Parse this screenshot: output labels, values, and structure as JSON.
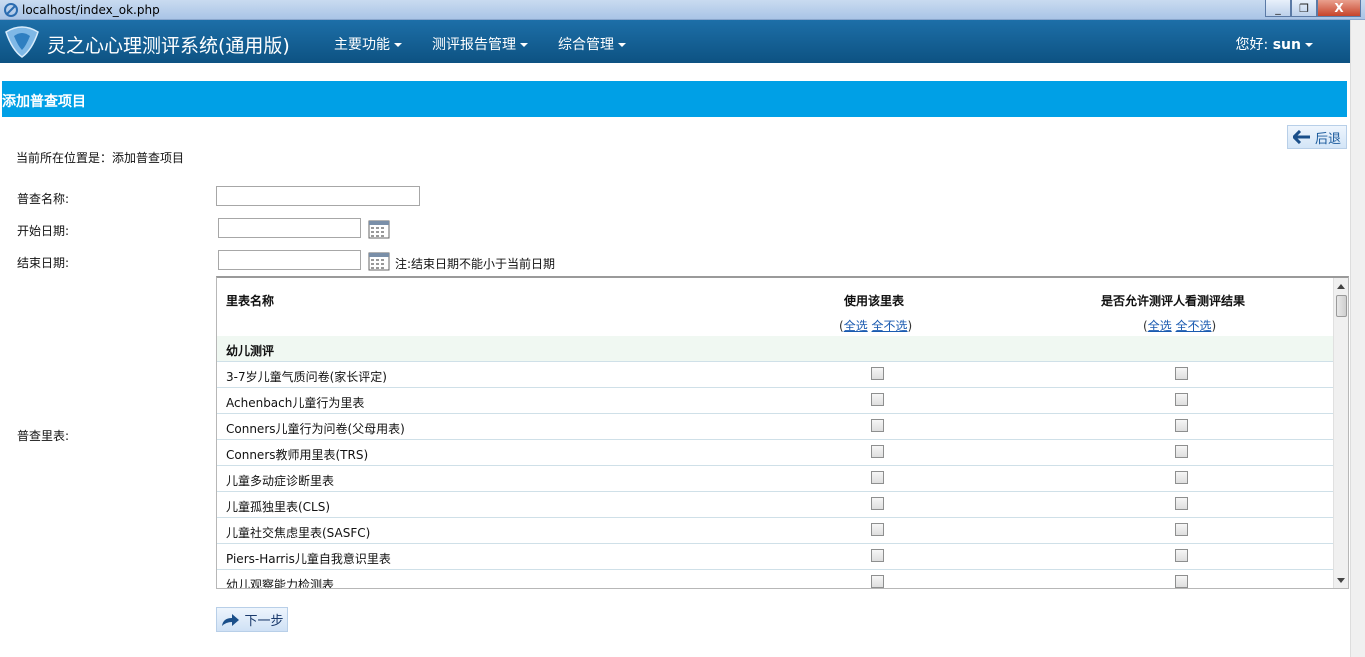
{
  "window": {
    "title": "localhost/index_ok.php",
    "minimize": "_",
    "maximize": "❐",
    "close": "X"
  },
  "navbar": {
    "brand": "灵之心心理测评系统(通用版)",
    "menu": [
      {
        "label": "主要功能"
      },
      {
        "label": "测评报告管理"
      },
      {
        "label": "综合管理"
      }
    ],
    "greeting_prefix": "您好:",
    "username": "sun"
  },
  "page": {
    "section_title": "添加普查项目",
    "back_label": "后退",
    "location": "当前所在位置是：添加普查项目",
    "labels": {
      "name": "普查名称:",
      "start": "开始日期:",
      "end": "结束日期:",
      "scales": "普查里表:"
    },
    "values": {
      "name": "",
      "start": "",
      "end": ""
    },
    "end_note": "注:结束日期不能小于当前日期",
    "next_label": "下一步"
  },
  "table": {
    "col_name": "里表名称",
    "col_use": "使用该里表",
    "col_allow": "是否允许测评人看测评结果",
    "select_all": "全选",
    "select_none": "全不选",
    "group": "幼儿测评",
    "rows": [
      {
        "name": "3-7岁儿童气质问卷(家长评定)"
      },
      {
        "name": "Achenbach儿童行为里表"
      },
      {
        "name": "Conners儿童行为问卷(父母用表)"
      },
      {
        "name": "Conners教师用里表(TRS)"
      },
      {
        "name": "儿童多动症诊断里表"
      },
      {
        "name": "儿童孤独里表(CLS)"
      },
      {
        "name": "儿童社交焦虑里表(SASFC)"
      },
      {
        "name": "Piers-Harris儿童自我意识里表"
      },
      {
        "name": "幼儿观察能力检测表"
      }
    ]
  }
}
